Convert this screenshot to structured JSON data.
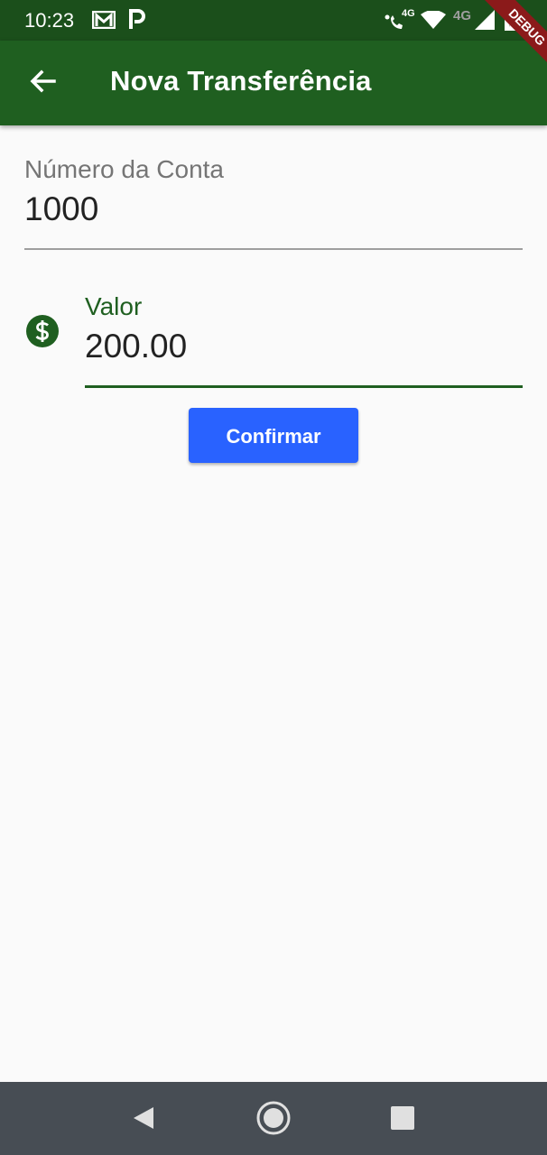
{
  "status_bar": {
    "time": "10:23",
    "network_label_1": "4G",
    "network_label_2": "4G",
    "icons": [
      "gmail-icon",
      "parking-icon",
      "wifi-call-icon",
      "wifi-icon",
      "signal-icon",
      "battery-icon"
    ]
  },
  "debug_banner": "DEBUG",
  "app_bar": {
    "title": "Nova Transferência",
    "back_icon": "arrow-back-icon",
    "background_color": "#1f5f20"
  },
  "form": {
    "account_field": {
      "label": "Número da Conta",
      "value": "1000"
    },
    "value_field": {
      "label": "Valor",
      "value": "200.00",
      "icon": "monetization-on-icon"
    },
    "confirm_button": {
      "label": "Confirmar",
      "color": "#2962ff"
    }
  },
  "nav_bar": {
    "buttons": [
      "back-triangle-icon",
      "home-circle-icon",
      "recents-square-icon"
    ]
  },
  "colors": {
    "primary": "#1f5f20",
    "status_bar": "#1b4f1b",
    "accent": "#2962ff",
    "background": "#fafafa"
  }
}
